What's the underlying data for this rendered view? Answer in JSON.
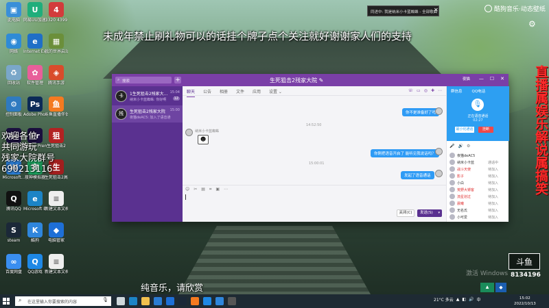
{
  "overlay": {
    "top_caption": "未成年禁止刷礼物可以的话挂个牌子点个关注就好谢谢家人们的支持",
    "left_lines": [
      "欢迎各位",
      "共同游玩",
      "残家大院群号",
      "690213116"
    ],
    "right_vertical": "直播属娱乐解说属搞笑",
    "bottom_caption": "纯音乐，请欣赏"
  },
  "music_app": {
    "name": "酷狗音乐·动态壁纸"
  },
  "toast": {
    "text": "同进中: 我是纳米小卡蓝蜘蛛 - 全部歌曲"
  },
  "desktop_icons": [
    {
      "label": "此电脑",
      "color": "#3a8fd8",
      "glyph": "▣"
    },
    {
      "label": "网易UU加速器",
      "color": "#1fae7b",
      "glyph": "U"
    },
    {
      "label": "3320 4399",
      "color": "#d23b3b",
      "glyph": "4"
    },
    {
      "label": "网络",
      "color": "#2f8bd6",
      "glyph": "◉"
    },
    {
      "label": "Internet Explorer",
      "color": "#1f6fc7",
      "glyph": "e"
    },
    {
      "label": "我的世界启动器",
      "color": "#6b8f3a",
      "glyph": "▦"
    },
    {
      "label": "回收站",
      "color": "#7aa7c9",
      "glyph": "♻"
    },
    {
      "label": "软件管理",
      "color": "#e85f9a",
      "glyph": "✿"
    },
    {
      "label": "腾讯手游",
      "color": "#d94c2b",
      "glyph": "◈"
    },
    {
      "label": "控制面板",
      "color": "#2f7ac0",
      "glyph": "⚙"
    },
    {
      "label": "Adobe Photosh...",
      "color": "#0b2a57",
      "glyph": "Ps"
    },
    {
      "label": "斗鱼直播伴侣",
      "color": "#f47a20",
      "glyph": "鱼"
    },
    {
      "label": "Adobe After...",
      "color": "#1c1140",
      "glyph": "Ae"
    },
    {
      "label": "Adobe Premiere",
      "color": "#1b0f3e",
      "glyph": "Pr"
    },
    {
      "label": "生死狙击2",
      "color": "#b22222",
      "glyph": "狙"
    },
    {
      "label": "Microsoft...",
      "color": "#2b7cd3",
      "glyph": "W"
    },
    {
      "label": "夜神模拟器",
      "color": "#1a9e5c",
      "glyph": "夜"
    },
    {
      "label": "生死狙击2高配版",
      "color": "#a11e1e",
      "glyph": "生"
    },
    {
      "label": "腾讯QQ",
      "color": "#111",
      "glyph": "Q"
    },
    {
      "label": "Microsoft Edge",
      "color": "#1c84c6",
      "glyph": "e"
    },
    {
      "label": "新建文本文档(2).txt",
      "color": "#eeeeee",
      "glyph": "≡"
    },
    {
      "label": "steam",
      "color": "#1b2838",
      "glyph": "S"
    },
    {
      "label": "酷狗",
      "color": "#2f86dc",
      "glyph": "K"
    },
    {
      "label": "电脑管家",
      "color": "#1e6fd6",
      "glyph": "◆"
    },
    {
      "label": "百度网盘",
      "color": "#3a8ef0",
      "glyph": "∞"
    },
    {
      "label": "QQ游戏",
      "color": "#1e88e5",
      "glyph": "Q"
    },
    {
      "label": "新建文本文档.txt",
      "color": "#eeeeee",
      "glyph": "≡"
    }
  ],
  "app": {
    "search_placeholder": "搜索",
    "title": "生死狙击2残家大院",
    "title_right_small": "夜猫",
    "window_controls": [
      "—",
      "☐",
      "✕"
    ],
    "conversations": [
      {
        "name": "1生死狙击2残家大...",
        "msg": "纳米小卡蓝蜘蛛: 你好啊",
        "time": "15:04",
        "badge": "12",
        "avatar": "卡"
      },
      {
        "name": "生死狙击2残家大院",
        "msg": "夜猫deAC5: 加入了语音通话",
        "time": "15:00",
        "badge": "",
        "avatar": "残"
      }
    ],
    "tabs": [
      "聊天",
      "公告",
      "相册",
      "文件",
      "应用",
      "设置 ⌄"
    ],
    "tab_icons": [
      "☏",
      "▭",
      "◎",
      "✚",
      "⋯"
    ],
    "messages": {
      "out1": "你不是准备好了吗",
      "time1": "14:52:50",
      "incoming_name": "纳米小卡蓝蜘蛛",
      "out2": "你刚把语音开启了 能听见我说话吗？",
      "time2": "15:00:01",
      "out3": "发起了语音通话"
    },
    "composer_icons": [
      "☺",
      "✂",
      "▤",
      "⌗",
      "▣",
      "⋯"
    ],
    "close_label": "关闭(C)",
    "send_label": "发送(S)",
    "right_panel": {
      "tabs": [
        "群信息",
        "QQ电话"
      ],
      "voice_status": "正在语音通话",
      "voice_time": "02:27",
      "btn_minimize": "最小化通话",
      "btn_hangup": "挂断",
      "vol_icons": [
        "🎤",
        "🔊",
        "⚙"
      ],
      "members": [
        {
          "name": "夜猫deAC5",
          "status": "",
          "red": false
        },
        {
          "name": "纳米小卡蓝",
          "status": "通话中",
          "red": false
        },
        {
          "name": "战斗天使",
          "status": "待加入",
          "red": true
        },
        {
          "name": "影子",
          "status": "待加入",
          "red": true
        },
        {
          "name": "小白",
          "status": "待加入",
          "red": false
        },
        {
          "name": "荒野大镖客",
          "status": "待加入",
          "red": true
        },
        {
          "name": "流星划过",
          "status": "待加入",
          "red": true
        },
        {
          "name": "晨曦",
          "status": "待加入",
          "red": true
        },
        {
          "name": "无名氏",
          "status": "待加入",
          "red": false
        },
        {
          "name": "小可爱",
          "status": "待加入",
          "red": false
        }
      ]
    }
  },
  "watermark": {
    "text": "激活 Windows"
  },
  "douyu": {
    "logo": "斗鱼",
    "number": "8134196"
  },
  "taskbar": {
    "search_placeholder": "在这里输入你要搜索的内容",
    "weather": "21°C 多云",
    "tray_icons": [
      "▲",
      "◧",
      "🔊",
      "中"
    ],
    "time": "15:02",
    "date": "2022/10/13",
    "apps": [
      {
        "name": "task-view",
        "color": "#cfd8dc"
      },
      {
        "name": "edge",
        "color": "#1c84c6"
      },
      {
        "name": "explorer",
        "color": "#f2c14e"
      },
      {
        "name": "store",
        "color": "#2b7cd3"
      },
      {
        "name": "mail",
        "color": "#1e6fd6"
      },
      {
        "name": "steam",
        "color": "#1b2838"
      },
      {
        "name": "douyu",
        "color": "#f47a20"
      },
      {
        "name": "qq",
        "color": "#1e88e5"
      },
      {
        "name": "kugou",
        "color": "#2f86dc"
      },
      {
        "name": "obs",
        "color": "#555"
      }
    ]
  }
}
